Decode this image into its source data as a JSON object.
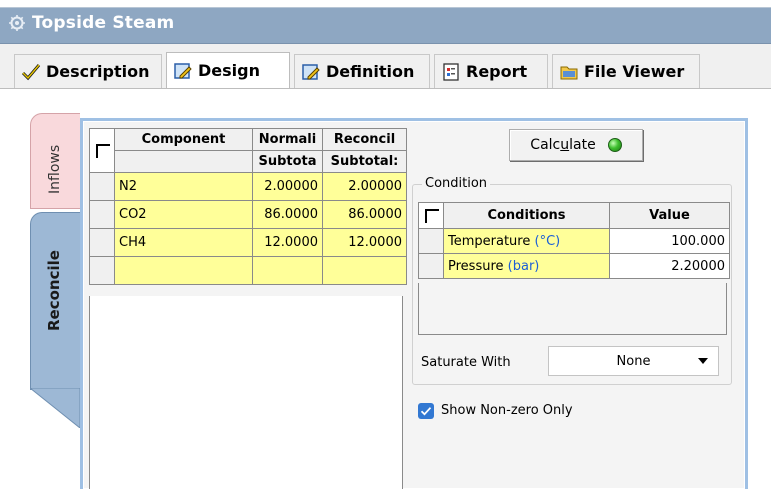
{
  "window": {
    "title": "Topside Steam"
  },
  "tabs": [
    {
      "label": "Description",
      "active": false
    },
    {
      "label": "Design",
      "active": true
    },
    {
      "label": "Definition",
      "active": false
    },
    {
      "label": "Report",
      "active": false
    },
    {
      "label": "File Viewer",
      "active": false
    }
  ],
  "side_tabs": [
    {
      "label": "Inflows",
      "color": "#f9d9dc"
    },
    {
      "label": "Reconcile",
      "color": "#9db8d5",
      "active": true
    }
  ],
  "composition_grid": {
    "headers": [
      "Component",
      "Normali",
      "Reconcil"
    ],
    "subheaders": [
      "",
      "Subtota",
      "Subtotal:"
    ],
    "rows": [
      {
        "component": "N2",
        "normalized": "2.00000",
        "reconciled": "2.00000"
      },
      {
        "component": "CO2",
        "normalized": "86.0000",
        "reconciled": "86.0000"
      },
      {
        "component": "CH4",
        "normalized": "12.0000",
        "reconciled": "12.0000"
      },
      {
        "component": "",
        "normalized": "",
        "reconciled": ""
      }
    ]
  },
  "calculate_button": {
    "label_pre": "Calc",
    "label_ul": "u",
    "label_post": "late",
    "status_color": "#3fbf2f"
  },
  "condition_group": {
    "title": "Condition",
    "headers": [
      "Conditions",
      "Value"
    ],
    "rows": [
      {
        "name": "Temperature",
        "unit": "(°C)",
        "value": "100.000"
      },
      {
        "name": "Pressure",
        "unit": "(bar)",
        "value": "2.20000"
      }
    ]
  },
  "saturate": {
    "label": "Saturate With",
    "value": "None"
  },
  "show_nonzero": {
    "label": "Show Non-zero Only",
    "checked": true
  },
  "colors": {
    "accent": "#3278d2",
    "title_bar": "#8ea7c2",
    "cell_yellow": "#ffff99",
    "unit_blue": "#1c5fd6"
  }
}
